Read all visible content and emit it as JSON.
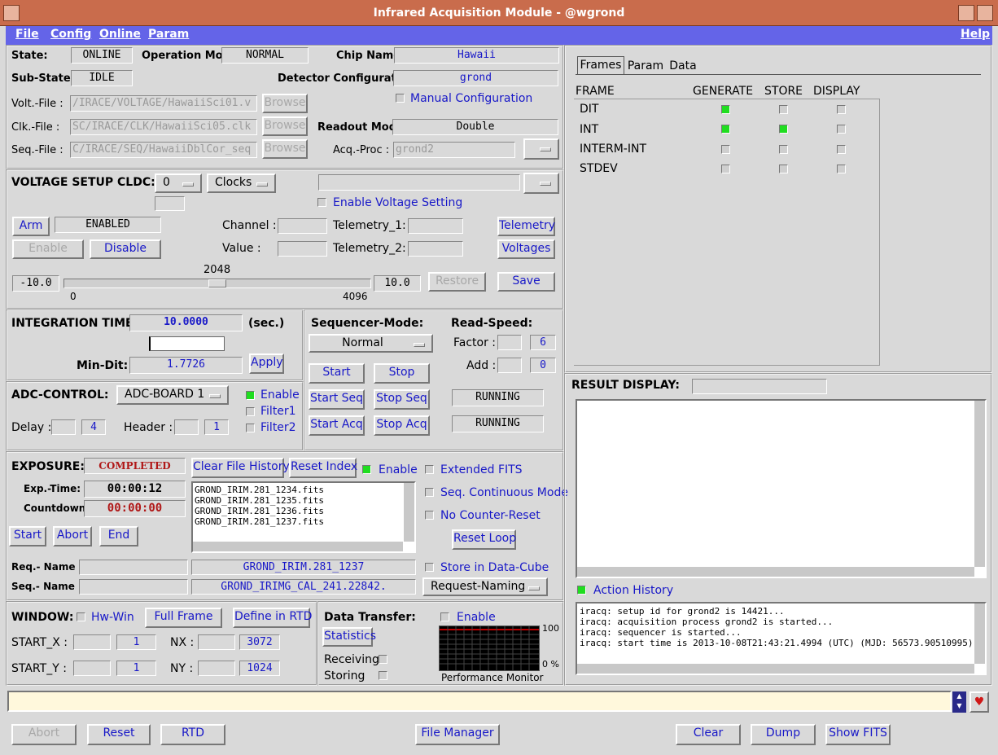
{
  "title": "Infrared Acquisition Module - @wgrond",
  "menu": {
    "file": "File",
    "config": "Config",
    "online": "Online",
    "param": "Param",
    "help": "Help"
  },
  "status": {
    "state_label": "State:",
    "state": "ONLINE",
    "opmode_label": "Operation Mode:",
    "opmode": "NORMAL",
    "chip_label": "Chip Name:",
    "chip": "Hawaii",
    "substate_label": "Sub-State:",
    "substate": "IDLE",
    "detconf_label": "Detector Configuration:",
    "detconf": "grond"
  },
  "files": {
    "volt_label": "Volt.-File :",
    "volt": "/IRACE/VOLTAGE/HawaiiSci01.v",
    "clk_label": "Clk.-File :",
    "clk": "SC/IRACE/CLK/HawaiiSci05.clk",
    "seq_label": "Seq.-File :",
    "seq": "C/IRACE/SEQ/HawaiiDblCor_seq",
    "browse": "Browse",
    "manual": "Manual Configuration",
    "readout_label": "Readout Mode:",
    "readout": "Double",
    "acqproc_label": "Acq.-Proc :",
    "acqproc": "grond2"
  },
  "voltage": {
    "title": "VOLTAGE SETUP CLDC:",
    "num": "0",
    "clocks": "Clocks",
    "enable_setting": "Enable Voltage Setting",
    "arm": "Arm",
    "enabled": "ENABLED",
    "channel": "Channel :",
    "telemetry1": "Telemetry_1:",
    "telemetry_btn": "Telemetry",
    "enable": "Enable",
    "disable": "Disable",
    "value": "Value :",
    "telemetry2": "Telemetry_2:",
    "voltages": "Voltages",
    "min": "-10.0",
    "max": "10.0",
    "slider_value": "2048",
    "slider_lo": "0",
    "slider_hi": "4096",
    "restore": "Restore",
    "save": "Save"
  },
  "integration": {
    "title": "INTEGRATION TIME:",
    "value": "10.0000",
    "unit": "(sec.)",
    "mindit_label": "Min-Dit:",
    "mindit": "1.7726",
    "apply": "Apply"
  },
  "sequencer": {
    "title": "Sequencer-Mode:",
    "mode": "Normal",
    "speed_title": "Read-Speed:",
    "factor_label": "Factor :",
    "factor": "6",
    "add_label": "Add :",
    "add": "0",
    "start": "Start",
    "stop": "Stop",
    "start_seq": "Start Seq",
    "stop_seq": "Stop Seq",
    "start_acq": "Start Acq",
    "stop_acq": "Stop Acq",
    "status1": "RUNNING",
    "status2": "RUNNING"
  },
  "adc": {
    "title": "ADC-CONTROL:",
    "board": "ADC-BOARD 1",
    "enable": "Enable",
    "filter1": "Filter1",
    "filter2": "Filter2",
    "delay_label": "Delay :",
    "delay": "4",
    "header_label": "Header :",
    "header": "1"
  },
  "exposure": {
    "title": "EXPOSURE:",
    "status": "COMPLETED",
    "clear_history": "Clear File History",
    "reset_index": "Reset Index",
    "enable": "Enable",
    "exptime_label": "Exp.-Time:",
    "exptime": "00:00:12",
    "countdown_label": "Countdown:",
    "countdown": "00:00:00",
    "start": "Start",
    "abort": "Abort",
    "end": "End",
    "files": [
      "GROND_IRIM.281_1234.fits",
      "GROND_IRIM.281_1235.fits",
      "GROND_IRIM.281_1236.fits",
      "GROND_IRIM.281_1237.fits"
    ],
    "ext_fits": "Extended FITS",
    "seq_cont": "Seq. Continuous Mode",
    "no_counter": "No Counter-Reset",
    "reset_loop": "Reset Loop",
    "store_cube": "Store in Data-Cube",
    "reqname_label": "Req.- Name :",
    "reqname": "GROND_IRIM.281_1237",
    "seqname_label": "Seq.- Name :",
    "seqname": "GROND_IRIMG_CAL_241.22842.",
    "request_naming": "Request-Naming"
  },
  "window": {
    "title": "WINDOW:",
    "hwwin": "Hw-Win",
    "full_frame": "Full Frame",
    "define_rtd": "Define in RTD",
    "startx_label": "START_X :",
    "startx": "1",
    "nx_label": "NX :",
    "nx": "3072",
    "starty_label": "START_Y :",
    "starty": "1",
    "ny_label": "NY :",
    "ny": "1024"
  },
  "transfer": {
    "title": "Data Transfer:",
    "enable": "Enable",
    "statistics": "Statistics",
    "receiving": "Receiving",
    "storing": "Storing",
    "perf_hi": "100",
    "perf_lo": "0 %",
    "perf_label": "Performance Monitor"
  },
  "frames": {
    "tabs": [
      "Frames",
      "Param",
      "Data"
    ],
    "headers": [
      "FRAME",
      "GENERATE",
      "STORE",
      "DISPLAY"
    ],
    "rows": [
      {
        "name": "DIT",
        "gen": true,
        "store": false,
        "disp": false
      },
      {
        "name": "INT",
        "gen": true,
        "store": true,
        "disp": false
      },
      {
        "name": "INTERM-INT",
        "gen": false,
        "store": false,
        "disp": false
      },
      {
        "name": "STDEV",
        "gen": false,
        "store": false,
        "disp": false
      }
    ]
  },
  "result": {
    "title": "RESULT DISPLAY:",
    "action_history": "Action History",
    "log": [
      "iracq: setup id for grond2 is 14421...",
      "iracq: acquisition process grond2 is started...",
      "iracq: sequencer is started...",
      "iracq: start time is 2013-10-08T21:43:21.4994 (UTC) (MJD: 56573.90510995)"
    ]
  },
  "bottom": {
    "abort": "Abort",
    "reset": "Reset",
    "rtd": "RTD",
    "file_manager": "File Manager",
    "clear": "Clear",
    "dump": "Dump",
    "show_fits": "Show FITS"
  }
}
